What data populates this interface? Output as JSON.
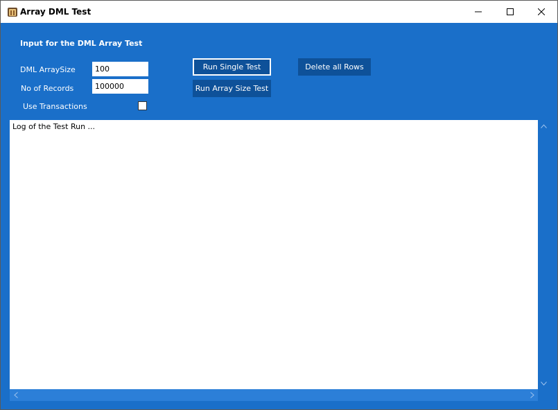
{
  "window": {
    "title": "Array DML Test",
    "app_icon": "folder-app-icon",
    "controls": {
      "minimize": "minimize-icon",
      "maximize": "maximize-icon",
      "close": "close-icon"
    }
  },
  "form": {
    "section_title": "Input for the DML Array Test",
    "array_size_label": "DML ArraySize",
    "array_size_value": "100",
    "records_label": "No of Records",
    "records_value": "100000",
    "transactions_label": "Use Transactions",
    "transactions_checked": false
  },
  "buttons": {
    "run_single": "Run Single Test",
    "run_array_size": "Run Array Size Test",
    "delete_all": "Delete all Rows"
  },
  "log": {
    "text": "Log of the Test Run ..."
  },
  "colors": {
    "background": "#1a6fc9",
    "button": "#0e5199",
    "scrollbar": "#2c7fd8"
  }
}
